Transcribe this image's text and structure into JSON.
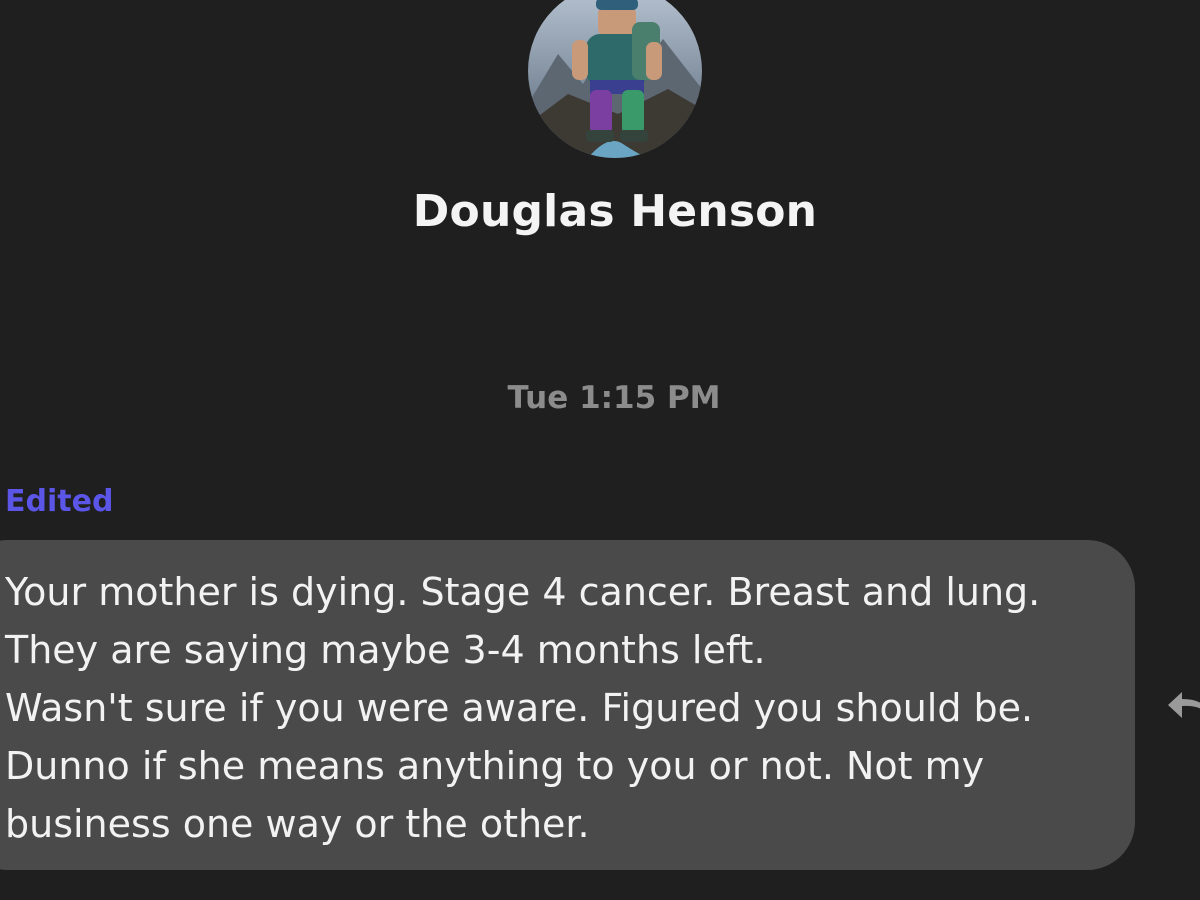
{
  "conversation": {
    "contact_name": "Douglas Henson",
    "avatar_icon": "avatar-photo",
    "timestamp": "Tue 1:15 PM"
  },
  "message": {
    "edited_label": "Edited",
    "lines": [
      "Your mother is dying. Stage 4 cancer. Breast and lung.",
      "They are saying maybe 3-4 months left.",
      "Wasn't sure if you were aware. Figured you should be.",
      "Dunno if she means anything to you or not. Not my",
      "business one way or the other."
    ],
    "reply_icon": "reply-arrow-icon"
  },
  "colors": {
    "background": "#1f1f1f",
    "bubble": "#4a4a4a",
    "edited": "#5b55e8",
    "timestamp": "#8c8c8c"
  }
}
